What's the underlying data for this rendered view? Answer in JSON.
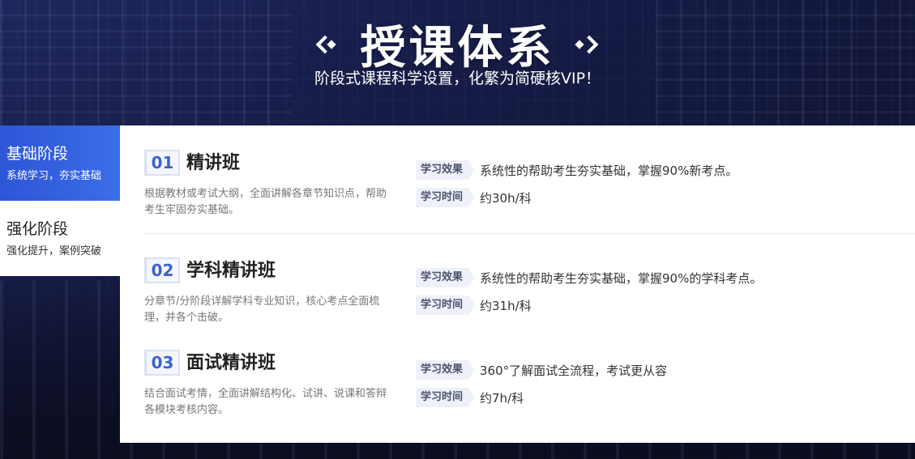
{
  "header": {
    "title": "授课体系",
    "subtitle": "阶段式课程科学设置，化繁为简硬核VIP！"
  },
  "sidebar": {
    "items": [
      {
        "title": "基础阶段",
        "subtitle": "系统学习，夯实基础",
        "active": true
      },
      {
        "title": "强化阶段",
        "subtitle": "强化提升，案例突破",
        "active": false
      }
    ]
  },
  "courses": [
    {
      "num": "01",
      "name": "精讲班",
      "desc": "根据教材或考试大纲，全面讲解各章节知识点，帮助考生牢固夯实基础。",
      "effect_label": "学习效果",
      "effect": "系统性的帮助考生夯实基础，掌握90%新考点。",
      "time_label": "学习时间",
      "time": "约30h/科"
    },
    {
      "num": "02",
      "name": "学科精讲班",
      "desc": "分章节/分阶段详解学科专业知识，核心考点全面梳理，并各个击破。",
      "effect_label": "学习效果",
      "effect": "系统性的帮助考生夯实基础，掌握90%的学科考点。",
      "time_label": "学习时间",
      "time": "约31h/科"
    },
    {
      "num": "03",
      "name": "面试精讲班",
      "desc": "结合面试考情，全面讲解结构化、试讲、说课和答辩各模块考核内容。",
      "effect_label": "学习效果",
      "effect": "360°了解面试全流程，考试更从容",
      "time_label": "学习时间",
      "time": "约7h/科"
    }
  ],
  "colors": {
    "accent": "#3c6de8",
    "number": "#3c63c9",
    "tag_bg": "#eef1f8"
  }
}
